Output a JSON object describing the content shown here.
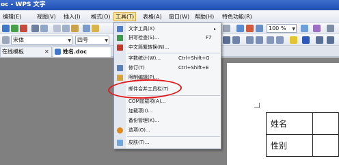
{
  "window": {
    "title": "oc - WPS 文字"
  },
  "menubar": {
    "items": [
      {
        "label": "编辑(E)"
      },
      {
        "label": "视图(V)"
      },
      {
        "label": "插入(I)"
      },
      {
        "label": "格式(O)"
      },
      {
        "label": "工具(T)"
      },
      {
        "label": "表格(A)"
      },
      {
        "label": "窗口(W)"
      },
      {
        "label": "帮助(H)"
      },
      {
        "label": "特色功能(R)"
      }
    ]
  },
  "toolbar": {
    "font_name": "宋体",
    "font_size": "四号",
    "zoom": "100 %"
  },
  "tabs": [
    {
      "label": "在线模板"
    },
    {
      "label": "姓名.doc"
    }
  ],
  "tools_menu": {
    "items": [
      {
        "label": "文字工具(X)",
        "shortcut": "",
        "submenu": "▸"
      },
      {
        "label": "拼写检查(S)...",
        "shortcut": "F7"
      },
      {
        "label": "中文简繁转换(N)...",
        "shortcut": ""
      },
      {
        "label": "字数统计(W)...",
        "shortcut": "Ctrl+Shift+G"
      },
      {
        "label": "修订(T)",
        "shortcut": "Ctrl+Shift+E"
      },
      {
        "label": "限制编辑(P)...",
        "shortcut": ""
      },
      {
        "label": "邮件合并工具栏(T)",
        "shortcut": ""
      },
      {
        "label": "COM加载项(A)...",
        "shortcut": ""
      },
      {
        "label": "加载项(I)...",
        "shortcut": ""
      },
      {
        "label": "备份管理(K)...",
        "shortcut": ""
      },
      {
        "label": "选项(O)...",
        "shortcut": ""
      },
      {
        "label": "皮肤(T)...",
        "shortcut": ""
      }
    ]
  },
  "document": {
    "table_rows": [
      {
        "cell": "姓名"
      },
      {
        "cell": "性别"
      }
    ]
  },
  "colors": {
    "highlight": "#e0191b",
    "accent": "#1f4fb5"
  }
}
